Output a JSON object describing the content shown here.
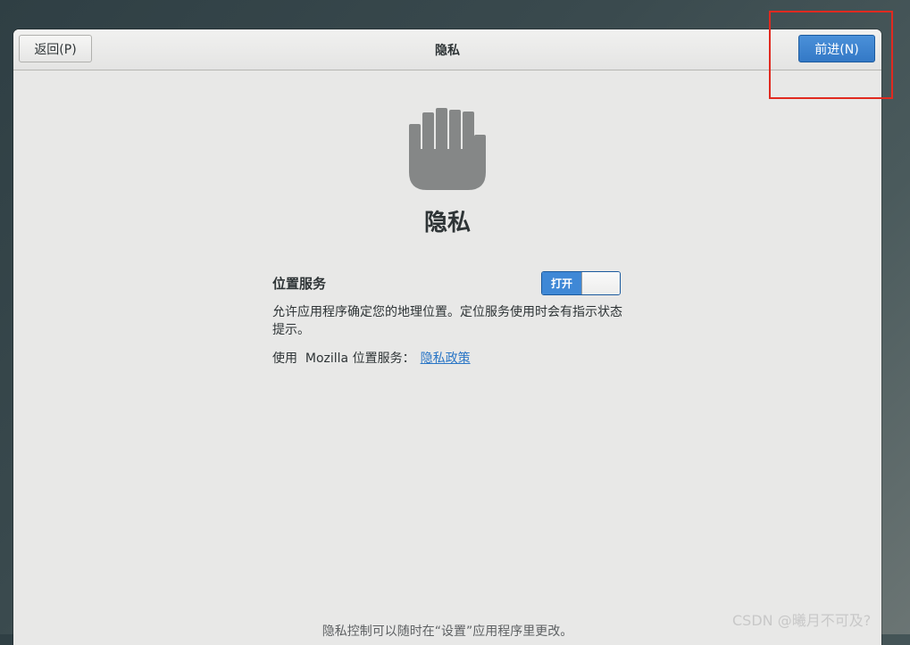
{
  "header": {
    "back_label": "返回(P)",
    "title": "隐私",
    "next_label": "前进(N)"
  },
  "main": {
    "icon": "hand-stop-icon",
    "title": "隐私",
    "location_service": {
      "label": "位置服务",
      "toggle_state": "打开",
      "description": "允许应用程序确定您的地理位置。定位服务使用时会有指示状态提示。",
      "uses_prefix": "使用  Mozilla 位置服务：",
      "policy_link": "隐私政策"
    },
    "footer_note": "隐私控制可以随时在“设置”应用程序里更改。"
  },
  "annotation": {
    "highlight_color": "#e02a20"
  },
  "watermark": "CSDN @曦月不可及?",
  "colors": {
    "accent": "#3f88d6",
    "link": "#2a76c6",
    "icon_gray": "#858787"
  }
}
